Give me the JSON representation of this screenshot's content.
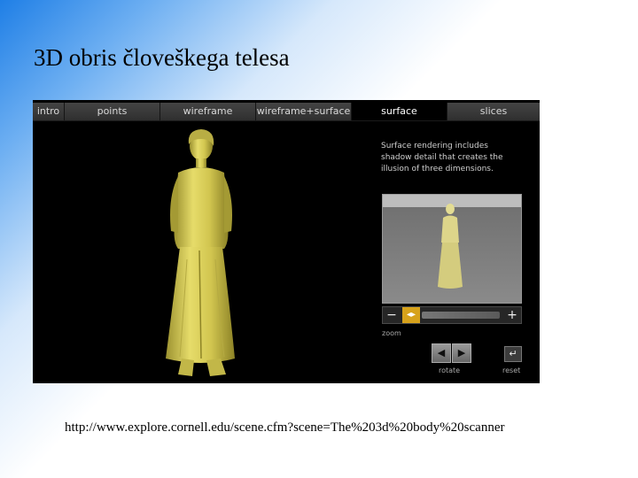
{
  "slide": {
    "title": "3D obris človeškega telesa",
    "url": "http://www.explore.cornell.edu/scene.cfm?scene=The%203d%20body%20scanner"
  },
  "app": {
    "tabs": [
      {
        "label": "intro"
      },
      {
        "label": "points"
      },
      {
        "label": "wireframe"
      },
      {
        "label": "wireframe+surface"
      },
      {
        "label": "surface",
        "active": true
      },
      {
        "label": "slices"
      }
    ],
    "caption": "Surface rendering includes shadow detail that creates the illusion of three dimensions.",
    "zoom": {
      "label": "zoom",
      "minus": "−",
      "plus": "+",
      "handle_icon": "◂▸"
    },
    "rotate": {
      "label": "rotate",
      "left_icon": "◀",
      "right_icon": "▶"
    },
    "reset": {
      "label": "reset",
      "icon": "↵"
    }
  },
  "colors": {
    "figure": "#d8cc52",
    "figure_shadow": "#8e8426",
    "active_tab_bg": "#000000",
    "zoom_handle": "#d7a21b"
  }
}
